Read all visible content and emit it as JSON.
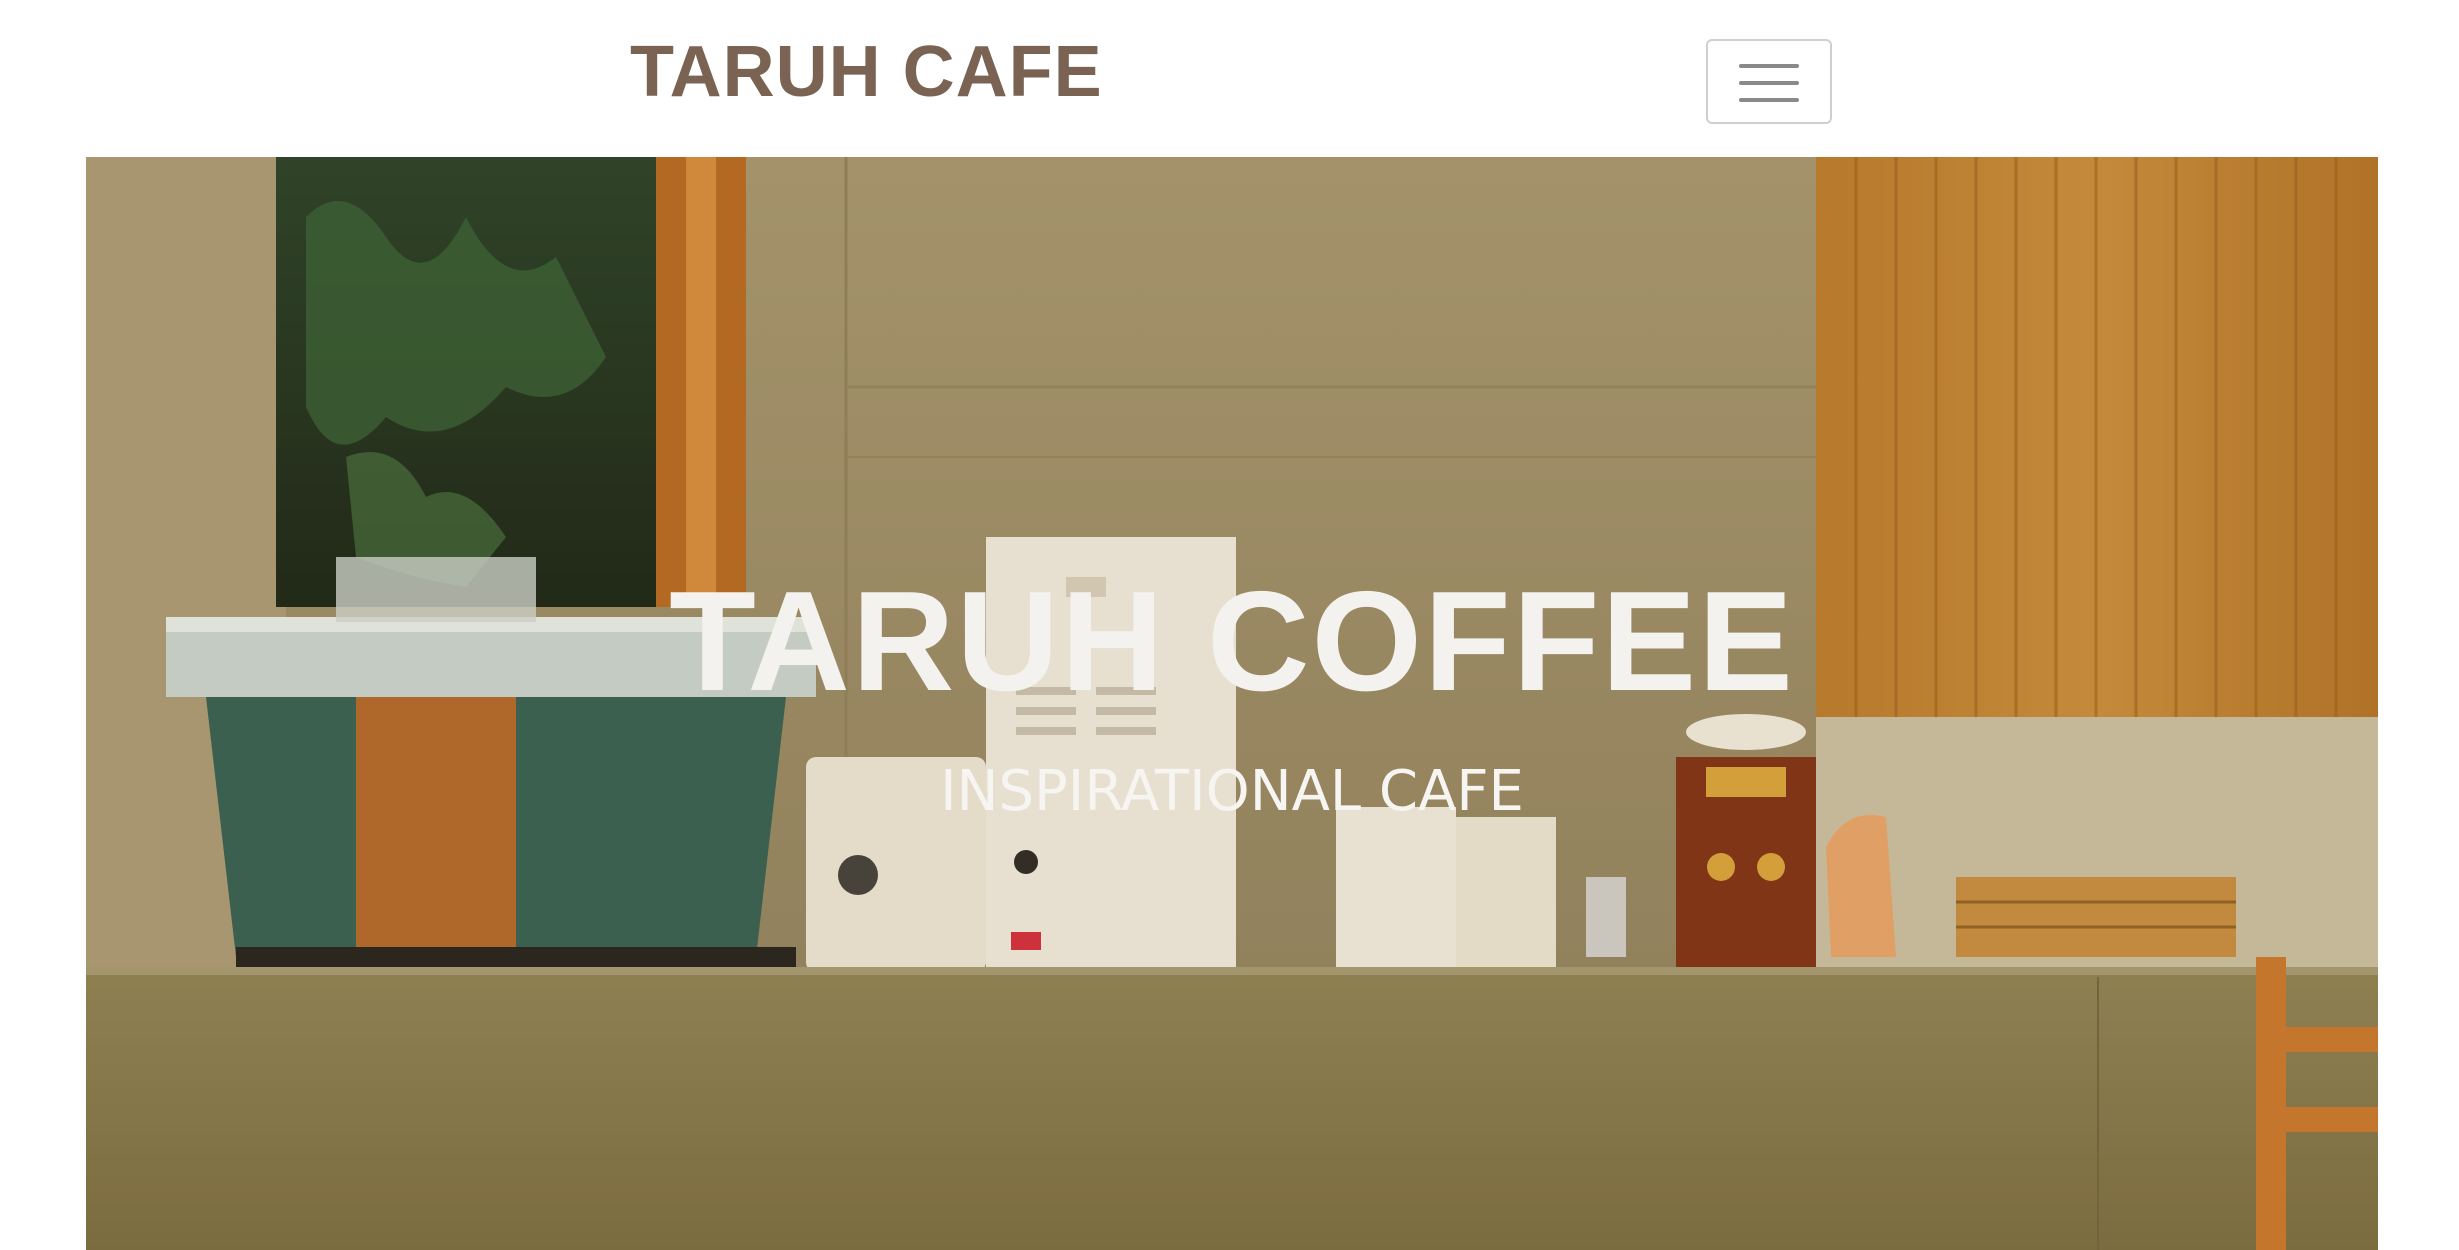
{
  "navbar": {
    "brand": "TARUH CAFE",
    "menu_toggle_icon": "hamburger-icon"
  },
  "hero": {
    "title": "TARUH COFFEE",
    "subtitle": "INSPIRATIONAL CAFE",
    "image_description_icon": "cafe-counter-photo"
  },
  "colors": {
    "brand": "#7a6353",
    "toggle_border": "#cfcfcf",
    "hero_text": "#f4f2ef"
  }
}
